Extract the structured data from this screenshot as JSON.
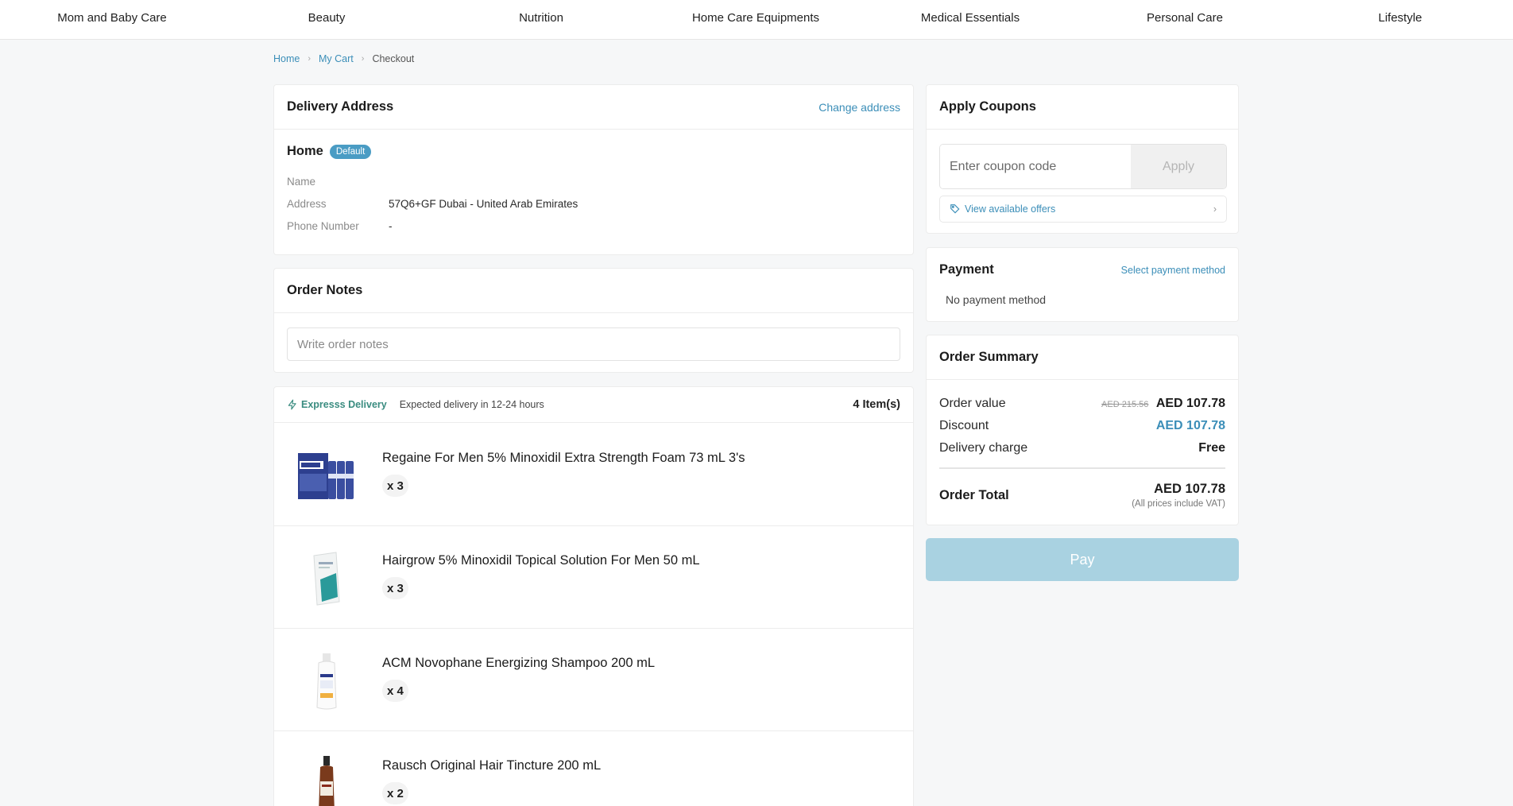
{
  "nav": {
    "items": [
      "Mom and Baby Care",
      "Beauty",
      "Nutrition",
      "Home Care Equipments",
      "Medical Essentials",
      "Personal Care",
      "Lifestyle"
    ]
  },
  "breadcrumb": {
    "home": "Home",
    "cart": "My Cart",
    "current": "Checkout"
  },
  "delivery": {
    "title": "Delivery Address",
    "change_link": "Change address",
    "label": "Home",
    "badge": "Default",
    "name_key": "Name",
    "name_value": "",
    "address_key": "Address",
    "address_value": "57Q6+GF Dubai - United Arab Emirates",
    "phone_key": "Phone Number",
    "phone_value": "-"
  },
  "notes": {
    "title": "Order Notes",
    "placeholder": "Write order notes"
  },
  "items": {
    "express_label": "Expresss Delivery",
    "expected": "Expected delivery in 12-24 hours",
    "count": "4 Item(s)",
    "products": [
      {
        "name": "Regaine For Men 5% Minoxidil Extra Strength Foam 73 mL 3's",
        "qty": "x 3"
      },
      {
        "name": "Hairgrow 5% Minoxidil Topical Solution For Men 50 mL",
        "qty": "x 3"
      },
      {
        "name": "ACM Novophane Energizing Shampoo 200 mL",
        "qty": "x 4"
      },
      {
        "name": "Rausch Original Hair Tincture 200 mL",
        "qty": "x 2"
      }
    ]
  },
  "coupons": {
    "title": "Apply Coupons",
    "placeholder": "Enter coupon code",
    "apply": "Apply",
    "offers": "View available offers"
  },
  "payment": {
    "title": "Payment",
    "select_link": "Select payment method",
    "none": "No payment method"
  },
  "summary": {
    "title": "Order Summary",
    "order_value_label": "Order value",
    "order_value_old": "AED 215.56",
    "order_value": "AED 107.78",
    "discount_label": "Discount",
    "discount": "AED 107.78",
    "delivery_label": "Delivery charge",
    "delivery": "Free",
    "total_label": "Order Total",
    "total": "AED 107.78",
    "vat_note": "(All prices include VAT)"
  },
  "pay_button": "Pay",
  "colors": {
    "accent": "#3b8eb8",
    "express": "#3a8c80",
    "pay_disabled": "#a9d2e1"
  }
}
